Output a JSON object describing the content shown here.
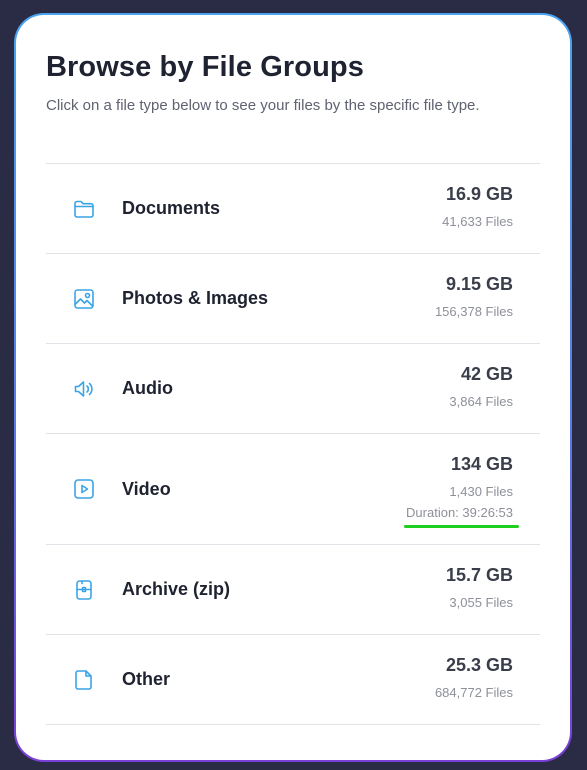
{
  "header": {
    "title": "Browse by File Groups",
    "subtitle": "Click on a file type below to see your files by the specific file type."
  },
  "colors": {
    "accent_icon": "#3ba4e6",
    "highlight_underline": "#1fcf1f",
    "background": "#2a2c45"
  },
  "groups": [
    {
      "label": "Documents",
      "size": "16.9 GB",
      "count": "41,633 Files",
      "icon": "folder-icon"
    },
    {
      "label": "Photos & Images",
      "size": "9.15 GB",
      "count": "156,378 Files",
      "icon": "image-icon"
    },
    {
      "label": "Audio",
      "size": "42 GB",
      "count": "3,864 Files",
      "icon": "speaker-icon"
    },
    {
      "label": "Video",
      "size": "134 GB",
      "count": "1,430 Files",
      "duration": "Duration: 39:26:53",
      "icon": "play-icon"
    },
    {
      "label": "Archive (zip)",
      "size": "15.7 GB",
      "count": "3,055 Files",
      "icon": "zip-icon"
    },
    {
      "label": "Other",
      "size": "25.3 GB",
      "count": "684,772 Files",
      "icon": "file-icon"
    }
  ]
}
